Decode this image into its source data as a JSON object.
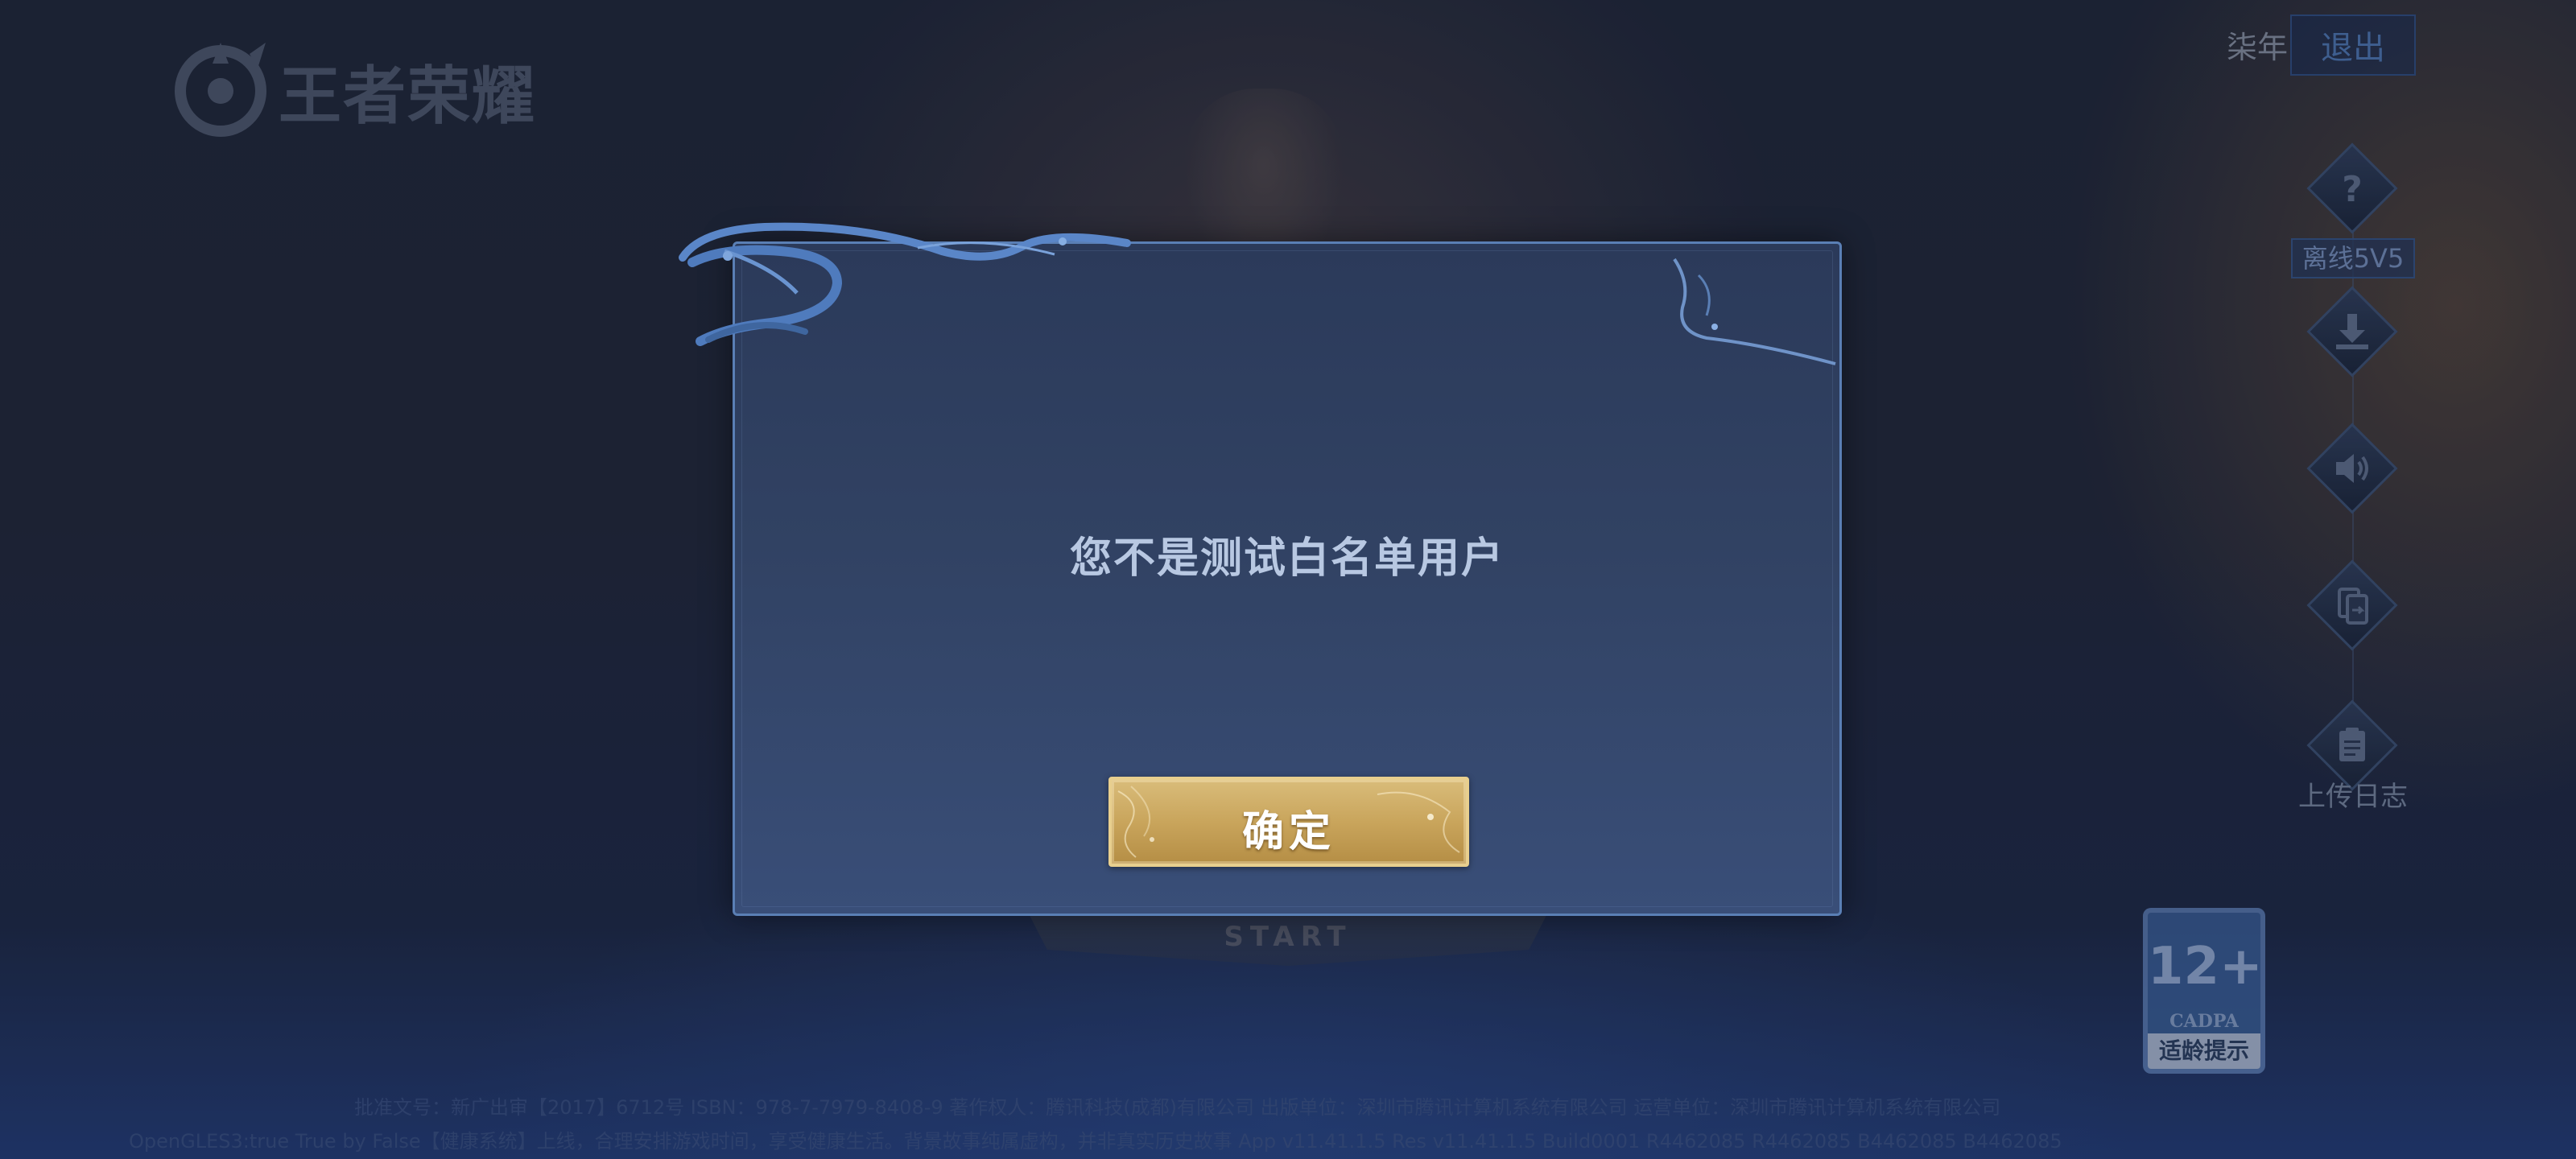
{
  "logo": {
    "text": "王者荣耀"
  },
  "account": {
    "name": "柒年",
    "exit_label": "退出"
  },
  "side_menu": {
    "offline_label": "离线5V5",
    "upload_log_label": "上传日志",
    "icons": [
      "help-icon",
      "download-icon",
      "sound-icon",
      "account-switch-icon",
      "upload-log-icon"
    ]
  },
  "background": {
    "start_label": "START"
  },
  "age_rating": {
    "rating": "12+",
    "org": "CADPA",
    "caption": "适龄提示"
  },
  "dialog": {
    "message": "您不是测试白名单用户",
    "confirm_label": "确定"
  },
  "footer": {
    "line1": "批准文号：新广出审【2017】6712号  ISBN：978-7-7979-8408-9  著作权人：腾讯科技(成都)有限公司  出版单位：深圳市腾讯计算机系统有限公司  运营单位：深圳市腾讯计算机系统有限公司",
    "line2": "OpenGLES3:true True by False【健康系统】上线，合理安排游戏时间，享受健康生活。背景故事纯属虚构，并非真实历史故事 App v11.41.1.5 Res v11.41.1.5 Build0001 R4462085 R4462085 B4462085 B4462085"
  },
  "colors": {
    "dialog_border": "#5a7fb5",
    "confirm_gold": "#c9a55c",
    "message_text": "#b8c8e2"
  }
}
